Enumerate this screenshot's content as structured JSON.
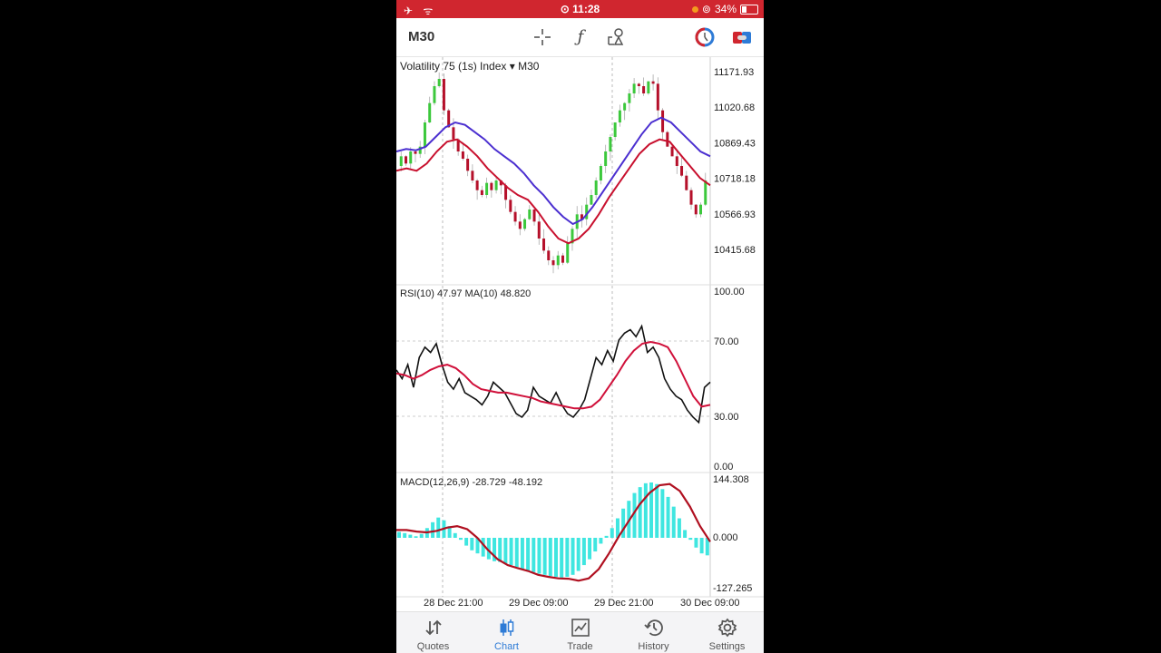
{
  "status_bar": {
    "time": "11:28",
    "battery": "34%",
    "icons": [
      "airplane-icon",
      "wifi-icon",
      "focus-icon",
      "orange-dot",
      "screen-lock-icon",
      "battery-icon"
    ]
  },
  "toolbar": {
    "timeframe": "M30",
    "icons": [
      "crosshair-icon",
      "indicators-f-icon",
      "objects-icon",
      "clock-circle-icon",
      "toggle-icon"
    ]
  },
  "main_chart": {
    "symbol": "Volatility 75 (1s) Index",
    "timeframe": "M30",
    "price_labels": [
      "11171.93",
      "11020.68",
      "10869.43",
      "10718.18",
      "10566.93",
      "10415.68"
    ]
  },
  "rsi": {
    "label": "RSI(10) 47.97 MA(10) 48.820",
    "levels": [
      "100.00",
      "70.00",
      "30.00",
      "0.00"
    ]
  },
  "macd": {
    "label": "MACD(12,26,9) -28.729 -48.192",
    "levels": [
      "144.308",
      "0.000",
      "-127.265"
    ]
  },
  "time_labels": [
    "28 Dec 21:00",
    "29 Dec 09:00",
    "29 Dec 21:00",
    "30 Dec 09:00"
  ],
  "colors": {
    "bull": "#3cc83c",
    "bear": "#b5102a",
    "ma_fast": "#c8102e",
    "ma_slow": "#4b2fd0",
    "hist": "#3fe6e0",
    "accent": "#2e7bd6",
    "status": "#d0262f"
  },
  "chart_data": {
    "type": "line",
    "title": "Volatility 75 (1s) Index M30",
    "price_range": [
      10340,
      11240
    ],
    "close_path": [
      10820,
      10860,
      10830,
      10880,
      10870,
      10900,
      11000,
      11080,
      11150,
      11180,
      11050,
      10980,
      10930,
      10880,
      10850,
      10800,
      10760,
      10720,
      10700,
      10750,
      10720,
      10760,
      10740,
      10680,
      10630,
      10590,
      10560,
      10600,
      10640,
      10590,
      10520,
      10470,
      10430,
      10410,
      10450,
      10420,
      10500,
      10560,
      10620,
      10600,
      10660,
      10700,
      10760,
      10820,
      10880,
      10940,
      11000,
      11050,
      11080,
      11120,
      11160,
      11150,
      11120,
      11170,
      11160,
      11050,
      10960,
      10900,
      10860,
      10820,
      10780,
      10720,
      10660,
      10620,
      10660,
      10760
    ],
    "ma_slow_path": [
      10880,
      10890,
      10885,
      10900,
      10940,
      10980,
      11000,
      10990,
      10960,
      10930,
      10890,
      10860,
      10830,
      10790,
      10740,
      10700,
      10650,
      10610,
      10580,
      10600,
      10650,
      10710,
      10770,
      10830,
      10890,
      10950,
      11000,
      11020,
      11000,
      10960,
      10920,
      10880,
      10860
    ],
    "ma_fast_path": [
      10800,
      10810,
      10800,
      10830,
      10880,
      10920,
      10930,
      10900,
      10860,
      10810,
      10770,
      10730,
      10700,
      10680,
      10630,
      10570,
      10520,
      10500,
      10520,
      10560,
      10620,
      10690,
      10750,
      10810,
      10870,
      10910,
      10930,
      10920,
      10870,
      10820,
      10770,
      10740
    ],
    "rsi_path": [
      55,
      50,
      58,
      45,
      62,
      68,
      65,
      70,
      58,
      48,
      44,
      50,
      42,
      40,
      38,
      35,
      40,
      48,
      45,
      42,
      36,
      30,
      28,
      32,
      45,
      40,
      38,
      36,
      42,
      35,
      30,
      28,
      32,
      38,
      50,
      62,
      58,
      66,
      60,
      72,
      76,
      78,
      74,
      80,
      65,
      68,
      62,
      50,
      44,
      40,
      38,
      32,
      28,
      25,
      45,
      48
    ],
    "rsi_ma_path": [
      53,
      52,
      50,
      52,
      55,
      57,
      58,
      56,
      52,
      47,
      44,
      43,
      42,
      42,
      41,
      40,
      39,
      37,
      36,
      35,
      34,
      33,
      33,
      34,
      38,
      45,
      52,
      60,
      66,
      70,
      71,
      70,
      68,
      60,
      50,
      40,
      34,
      35
    ],
    "macd_hist": [
      15,
      12,
      8,
      4,
      10,
      25,
      40,
      52,
      45,
      30,
      12,
      -5,
      -20,
      -32,
      -40,
      -48,
      -55,
      -60,
      -62,
      -66,
      -70,
      -75,
      -80,
      -85,
      -88,
      -92,
      -95,
      -98,
      -100,
      -102,
      -100,
      -95,
      -85,
      -70,
      -55,
      -35,
      -15,
      5,
      25,
      50,
      75,
      95,
      115,
      130,
      140,
      142,
      138,
      125,
      105,
      80,
      50,
      20,
      -5,
      -25,
      -40,
      -45
    ],
    "macd_signal": [
      20,
      20,
      16,
      14,
      18,
      26,
      30,
      22,
      0,
      -30,
      -55,
      -70,
      -78,
      -85,
      -95,
      -100,
      -104,
      -105,
      -110,
      -104,
      -80,
      -40,
      5,
      45,
      85,
      115,
      135,
      138,
      120,
      80,
      30,
      -10
    ]
  }
}
